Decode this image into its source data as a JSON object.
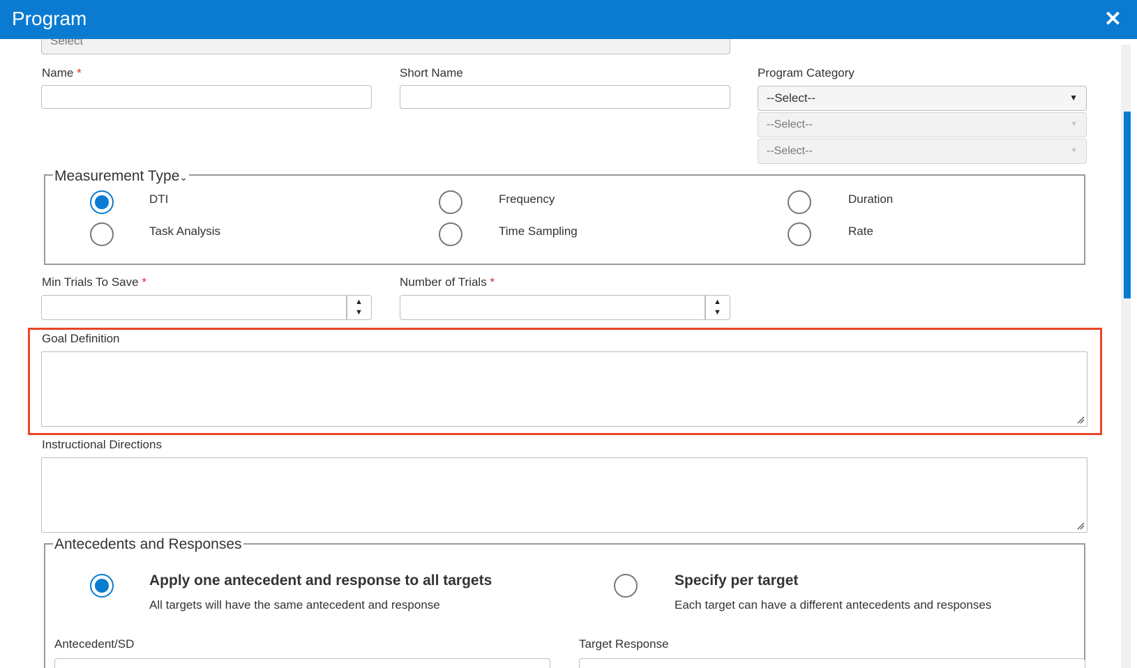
{
  "dialog": {
    "title": "Program",
    "close_icon": "close-icon"
  },
  "top_select": {
    "value": "Select"
  },
  "fields": {
    "name_label": "Name",
    "short_name_label": "Short Name",
    "program_category_label": "Program Category",
    "category_select_1": "--Select--",
    "category_select_2": "--Select--",
    "category_select_3": "--Select--",
    "required_marker": "*"
  },
  "measurement_type": {
    "legend": "Measurement Type",
    "options": [
      {
        "label": "DTI",
        "checked": true
      },
      {
        "label": "Frequency",
        "checked": false
      },
      {
        "label": "Duration",
        "checked": false
      },
      {
        "label": "Task Analysis",
        "checked": false
      },
      {
        "label": "Time Sampling",
        "checked": false
      },
      {
        "label": "Rate",
        "checked": false
      }
    ]
  },
  "trials": {
    "min_trials_label": "Min Trials To Save",
    "number_of_trials_label": "Number of Trials"
  },
  "goal_definition_label": "Goal Definition",
  "instructional_directions_label": "Instructional Directions",
  "antecedents": {
    "legend": "Antecedents and Responses",
    "option_all_title": "Apply one antecedent and response to all targets",
    "option_all_desc": "All targets will have the same antecedent and response",
    "option_per_title": "Specify per target",
    "option_per_desc": "Each target can have a different antecedents and responses",
    "antecedent_label": "Antecedent/SD",
    "target_response_label": "Target Response"
  },
  "colors": {
    "header": "#0a7bd1",
    "radio_selected": "#0a7bd1",
    "required": "#e02b2b",
    "highlight": "#e8472a"
  }
}
